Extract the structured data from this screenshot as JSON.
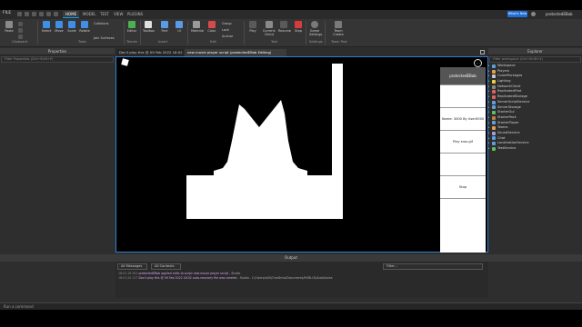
{
  "menu": {
    "file_label": "FILE",
    "tabs": [
      "HOME",
      "MODEL",
      "TEST",
      "VIEW",
      "PLUGINS"
    ],
    "active_tab": "HOME",
    "user_button": "What's New",
    "user_name": "protectedEBob"
  },
  "ribbon": {
    "clipboard": {
      "paste": "Paste",
      "label": "Clipboard"
    },
    "tools": {
      "select": "Select",
      "move": "Move",
      "scale": "Scale",
      "rotate": "Rotate",
      "collisions": "Collisions",
      "join": "Join Surfaces",
      "label": "Tools"
    },
    "terrain": {
      "editor": "Editor",
      "label": "Terrain"
    },
    "insert": {
      "toolbox": "Toolbox",
      "part": "Part",
      "ui": "UI",
      "label": "Insert"
    },
    "edit": {
      "material": "Material",
      "color": "Color",
      "group": "Group",
      "lock": "Lock",
      "anchor": "Anchor",
      "label": "Edit"
    },
    "test": {
      "play": "Play",
      "current_client": "Current: Client",
      "resume": "Resume",
      "stop": "Stop",
      "label": "Test"
    },
    "settings": {
      "game_settings": "Game Settings",
      "label": "Settings"
    },
    "team_test": {
      "team_create": "Team Create",
      "label": "Team Test"
    }
  },
  "properties": {
    "title": "Properties",
    "filter": "Filter Properties (Ctrl+Shift+P)"
  },
  "explorer": {
    "title": "Explorer",
    "filter": "Filter workspace (Ctrl+Shift+X)",
    "items": [
      {
        "label": "Workspace",
        "color": "#5aa0e0"
      },
      {
        "label": "Players",
        "color": "#e0a050"
      },
      {
        "label": "CoreePackages",
        "color": "#c8c8c8"
      },
      {
        "label": "Lighting",
        "color": "#f0d040"
      },
      {
        "label": "NetworkClient",
        "color": "#8a8a8a"
      },
      {
        "label": "ReplicatedFirst",
        "color": "#e06060"
      },
      {
        "label": "ReplicatedStorage",
        "color": "#e06060"
      },
      {
        "label": "ServerScriptService",
        "color": "#60a0e0"
      },
      {
        "label": "ServerStorage",
        "color": "#60a0e0"
      },
      {
        "label": "StarterGui",
        "color": "#60c060"
      },
      {
        "label": "StarterPack",
        "color": "#c08040"
      },
      {
        "label": "StarterPlayer",
        "color": "#60a0e0"
      },
      {
        "label": "Teams",
        "color": "#e0a050"
      },
      {
        "label": "SoundService",
        "color": "#a0a0e0"
      },
      {
        "label": "Chat",
        "color": "#60a0e0"
      },
      {
        "label": "LocalizationService",
        "color": "#60a0e0"
      },
      {
        "label": "TestService",
        "color": "#60c060"
      }
    ]
  },
  "viewport": {
    "tabs": [
      "Don't play this @ 09 Feb 2022 18:02",
      "new movie player script (protectedEBob Editing)"
    ],
    "side_panel": {
      "header": "protectedEBob",
      "items": [
        "",
        "Name: 3000 By User0000",
        "Play sras.gif",
        "",
        "Stop"
      ]
    },
    "menu_icon": "⋯"
  },
  "output": {
    "title": "Output",
    "all_messages": "All Messages",
    "all_contexts": "All Contexts",
    "filter": "Filter...",
    "lines": [
      {
        "time": "18:01:18.561",
        "text": "protectedEBob applied edits to script new movie player script",
        "suffix": " - Studio"
      },
      {
        "time": "18:01:20.127",
        "text": "Don't play this @ 09 Feb 2022 18:02 auto-recovery file was created",
        "suffix": " - Studio - C:/Users/w0X/OneDrive/Documents/ROBLOX/AutoSaves"
      }
    ]
  },
  "command": {
    "placeholder": "Run a command"
  }
}
